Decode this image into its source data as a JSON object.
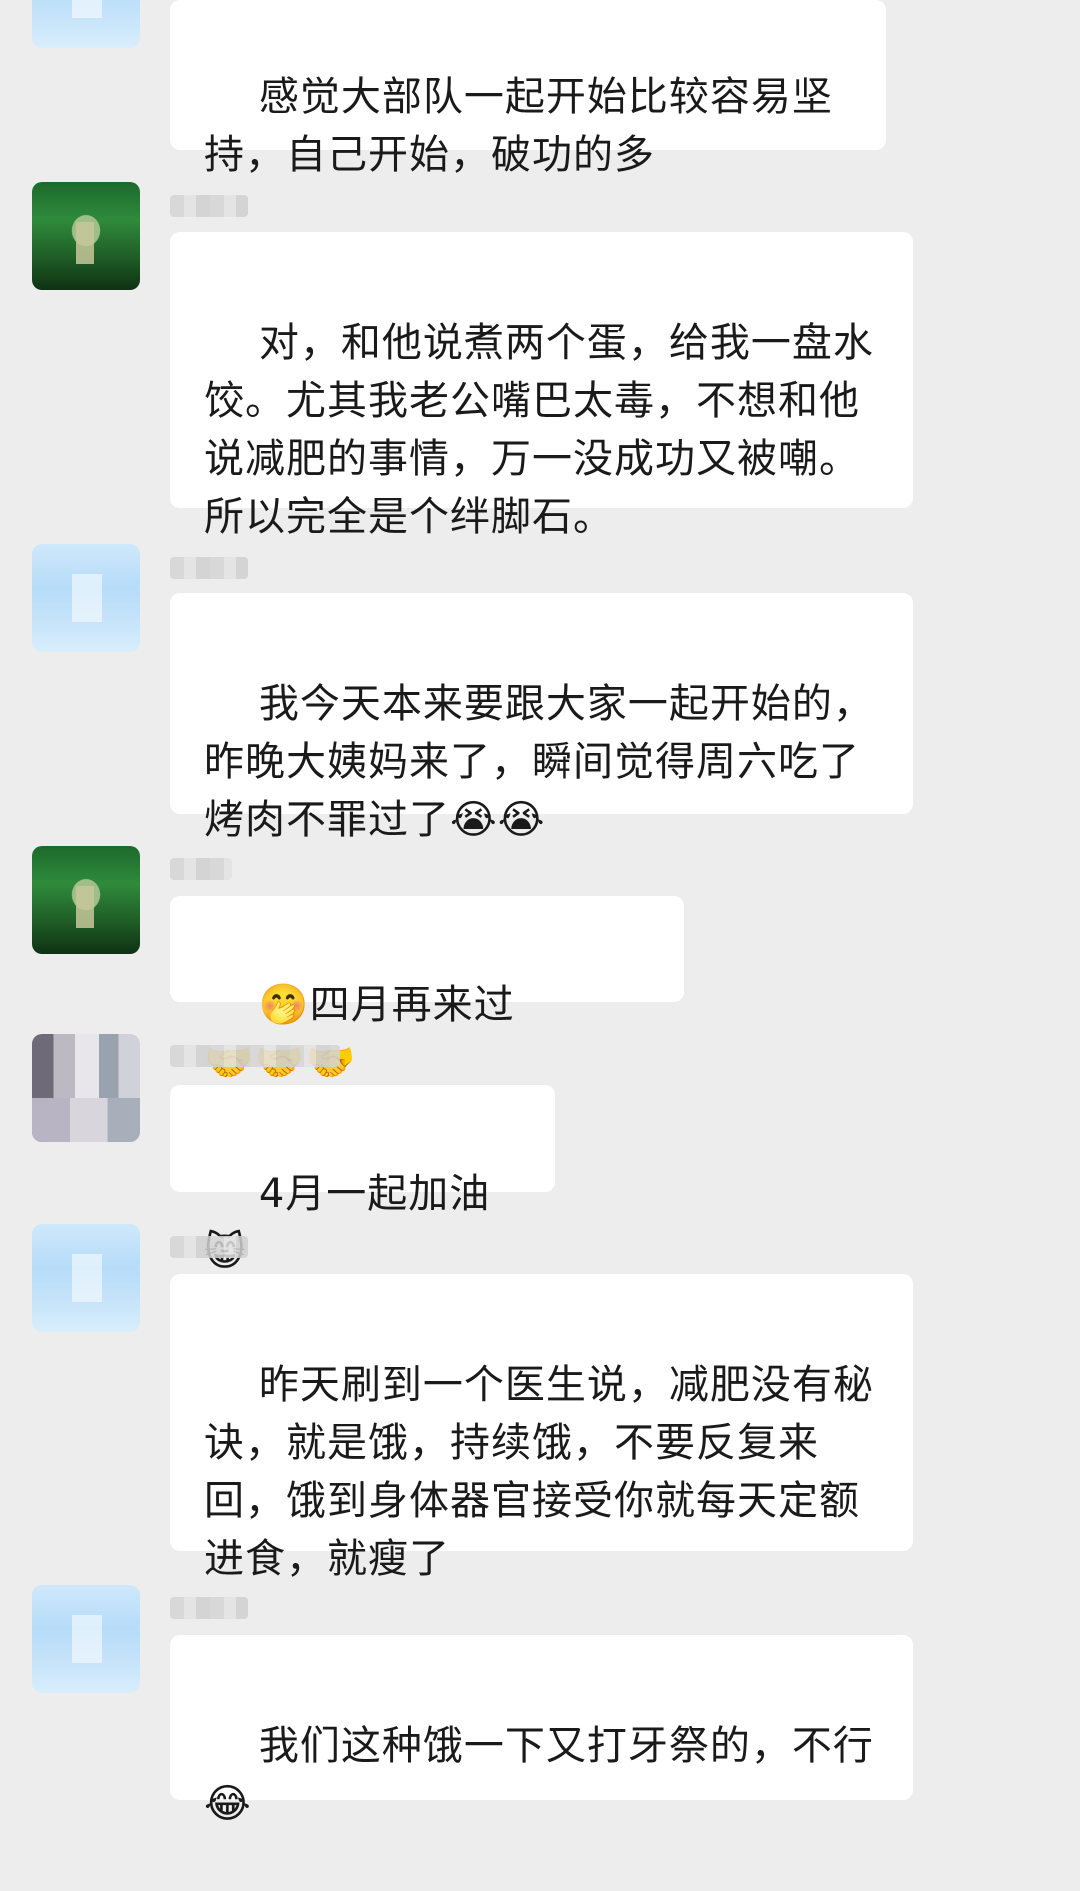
{
  "messages": [
    {
      "text": "感觉大部队一起开始比较容易坚持，自己开始，破功的多"
    },
    {
      "text": "对，和他说煮两个蛋，给我一盘水饺。尤其我老公嘴巴太毒，不想和他说减肥的事情，万一没成功又被嘲。所以完全是个绊脚石。"
    },
    {
      "text": "我今天本来要跟大家一起开始的，昨晚大姨妈来了，瞬间觉得周六吃了烤肉不罪过了",
      "emoji": "😭😭"
    },
    {
      "emoji_lead": "🤭",
      "text": "四月再来过",
      "emoji": "🤝🤝🤝"
    },
    {
      "text": "4月一起加油",
      "emoji": "😸"
    },
    {
      "text": "昨天刷到一个医生说，减肥没有秘诀，就是饿，持续饿，不要反复来回，饿到身体器官接受你就每天定额进食，就瘦了"
    },
    {
      "text": "我们这种饿一下又打牙祭的，不行",
      "emoji": "😂"
    }
  ]
}
